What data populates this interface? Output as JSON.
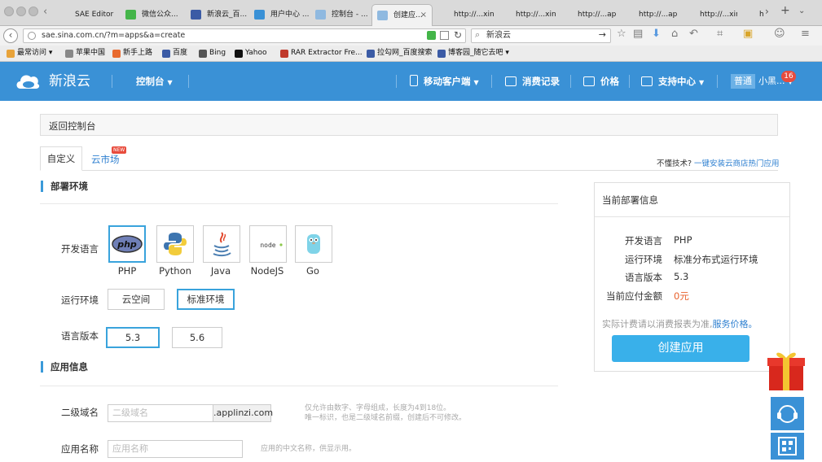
{
  "browser": {
    "tabs": [
      {
        "label": "SAE Editor",
        "color": "#dadada"
      },
      {
        "label": "微信公众...",
        "color": "#44b549"
      },
      {
        "label": "新浪云_百...",
        "color": "#3b5ba5"
      },
      {
        "label": "用户中心 ...",
        "color": "#3a91d6"
      },
      {
        "label": "控制台 - ...",
        "color": "#8fb9e0"
      },
      {
        "label": "创建应...",
        "color": "#8fb9e0"
      },
      {
        "label": "http://...xin.php",
        "color": "#dadada"
      },
      {
        "label": "http://...xin.php",
        "color": "#dadada"
      },
      {
        "label": "http://...api.php",
        "color": "#dadada"
      },
      {
        "label": "http://...api.php",
        "color": "#dadada"
      },
      {
        "label": "http://...xin.php",
        "color": "#dadada"
      },
      {
        "label": "http:",
        "color": "#dadada"
      }
    ],
    "url": "sae.sina.com.cn/?m=apps&a=create",
    "search": "新浪云",
    "bookmarks": [
      {
        "label": "最常访问",
        "color": "#e8a33a"
      },
      {
        "label": "苹果中国",
        "color": "#888888"
      },
      {
        "label": "新手上路",
        "color": "#e86a2e"
      },
      {
        "label": "百度",
        "color": "#3b5ba5"
      },
      {
        "label": "Bing",
        "color": "#555555"
      },
      {
        "label": "Yahoo",
        "color": "#111111"
      },
      {
        "label": "RAR Extractor Fre...",
        "color": "#c0392b"
      },
      {
        "label": "拉勾网_百度搜索",
        "color": "#3b5ba5"
      },
      {
        "label": "博客园_随它去吧",
        "color": "#3b5ba5"
      }
    ]
  },
  "topnav": {
    "brand": "新浪云",
    "console": "控制台",
    "mobile": "移动客户端",
    "billing": "消费记录",
    "price": "价格",
    "support": "支持中心",
    "level": "普通",
    "user": "小黑...",
    "badge": "16"
  },
  "back": "返回控制台",
  "tabs": {
    "custom": "自定义",
    "market": "云市场",
    "new": "NEW"
  },
  "help": {
    "q": "不懂技术?",
    "link": "一键安装云商店热门应用"
  },
  "deploy": {
    "title": "部署环境",
    "lang_label": "开发语言",
    "langs": [
      "PHP",
      "Python",
      "Java",
      "NodeJS",
      "Go"
    ],
    "env_label": "运行环境",
    "envs": [
      "云空间",
      "标准环境"
    ],
    "ver_label": "语言版本",
    "versions": [
      "5.3",
      "5.6"
    ]
  },
  "appinfo": {
    "title": "应用信息",
    "domain_label": "二级域名",
    "domain_placeholder": "二级域名",
    "domain_suffix": ".applinzi.com",
    "domain_hint1": "仅允许由数字、字母组成，长度为4到18位。",
    "domain_hint2": "唯一标识，也是二级域名前缀，创建后不可修改。",
    "name_label": "应用名称",
    "name_placeholder": "应用名称",
    "name_hint": "应用的中文名称，供显示用。"
  },
  "current": {
    "title": "当前部署信息",
    "rows": [
      {
        "k": "开发语言",
        "v": "PHP"
      },
      {
        "k": "运行环境",
        "v": "标准分布式运行环境"
      },
      {
        "k": "语言版本",
        "v": "5.3"
      },
      {
        "k": "当前应付金额",
        "v": "0元"
      }
    ],
    "note": "实际计费请以消费报表为准,",
    "note_link": "服务价格。",
    "create": "创建应用"
  }
}
